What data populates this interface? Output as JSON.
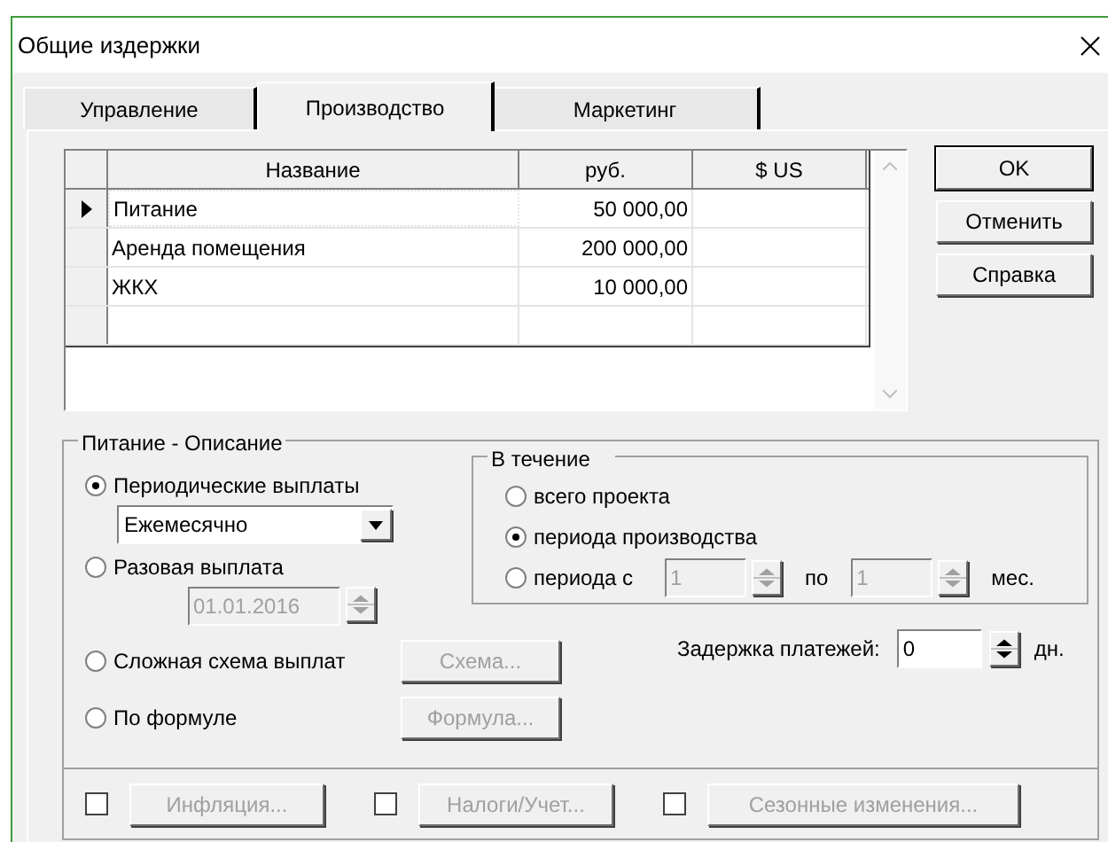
{
  "window": {
    "title": "Общие издержки"
  },
  "tabs": [
    {
      "label": "Управление",
      "selected": false
    },
    {
      "label": "Производство",
      "selected": true
    },
    {
      "label": "Маркетинг",
      "selected": false
    }
  ],
  "table": {
    "columns": [
      "Название",
      "руб.",
      "$ US"
    ],
    "rows": [
      {
        "cells": [
          "Питание",
          "50 000,00"
        ],
        "selected": true
      },
      {
        "cells": [
          "Аренда помещения",
          "200 000,00"
        ],
        "selected": false
      },
      {
        "cells": [
          "ЖКХ",
          "10 000,00"
        ],
        "selected": false
      }
    ]
  },
  "buttons": [
    {
      "label": "OK",
      "default": true
    },
    {
      "label": "Отменить",
      "default": false
    },
    {
      "label": "Справка",
      "default": false
    }
  ],
  "description": {
    "title": "Питание - Описание",
    "payment_options": [
      {
        "kind": "dropdown",
        "label": "Периодические выплаты",
        "selected": true,
        "value": "Ежемесячно"
      },
      {
        "kind": "date",
        "label": "Разовая выплата",
        "selected": false,
        "value": "01.01.2016",
        "disabled": true
      },
      {
        "kind": "button",
        "label": "Сложная схема выплат",
        "selected": false,
        "button": "Схема...",
        "disabled": true
      },
      {
        "kind": "button",
        "label": "По формуле",
        "selected": false,
        "button": "Формула...",
        "disabled": true
      }
    ],
    "during": {
      "title": "В течение",
      "options": [
        {
          "label": "всего проекта",
          "selected": false
        },
        {
          "label": "периода производства",
          "selected": true
        },
        {
          "label": "периода с",
          "selected": false
        }
      ],
      "from": "1",
      "to_label": "по",
      "to": "1",
      "unit": "мес.",
      "disabled": true
    },
    "delay": {
      "label": "Задержка платежей:",
      "value": "0",
      "unit": "дн."
    }
  },
  "bottom": [
    {
      "label": "Инфляция...",
      "checked": false,
      "disabled": true
    },
    {
      "label": "Налоги/Учет...",
      "checked": false,
      "disabled": true
    },
    {
      "label": "Сезонные изменения...",
      "checked": false,
      "disabled": true
    }
  ]
}
